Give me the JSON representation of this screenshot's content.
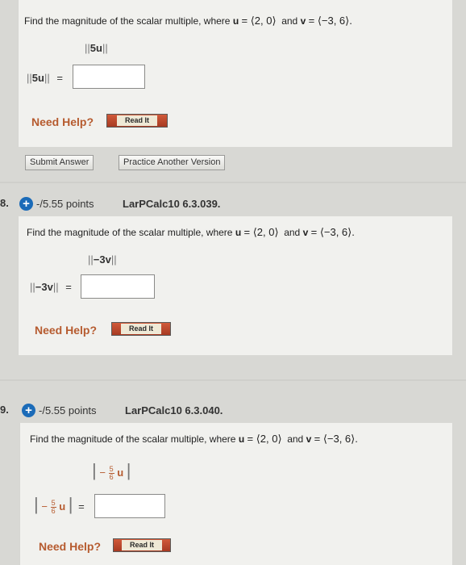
{
  "q1": {
    "prompt_prefix": "Find the magnitude of the scalar multiple, where",
    "u_label": "u",
    "u_value": "= ⟨2, 0⟩",
    "and": "and",
    "v_label": "v",
    "v_value": "= ⟨−3, 6⟩.",
    "norm_display": "5u",
    "answer_label": "5u",
    "equals": "=",
    "answer_value": "",
    "need_help": "Need Help?",
    "read_it": "Read It",
    "submit": "Submit Answer",
    "practice": "Practice Another Version"
  },
  "q2": {
    "number": "8.",
    "points": "-/5.55 points",
    "code": "LarPCalc10 6.3.039.",
    "prompt_prefix": "Find the magnitude of the scalar multiple, where",
    "u_label": "u",
    "u_value": "= ⟨2, 0⟩",
    "and": "and",
    "v_label": "v",
    "v_value": "= ⟨−3, 6⟩.",
    "norm_display": "−3v",
    "answer_label": "−3v",
    "equals": "=",
    "answer_value": "",
    "need_help": "Need Help?",
    "read_it": "Read It"
  },
  "q3": {
    "number": "9.",
    "points": "-/5.55 points",
    "code": "LarPCalc10 6.3.040.",
    "prompt_prefix": "Find the magnitude of the scalar multiple, where",
    "u_label": "u",
    "u_value": "= ⟨2, 0⟩",
    "and": "and",
    "v_label": "v",
    "v_value": "= ⟨−3, 6⟩.",
    "minus": "−",
    "frac_num": "5",
    "frac_den": "6",
    "vec": "u",
    "equals": "=",
    "answer_value": "",
    "need_help": "Need Help?",
    "read_it": "Read It"
  },
  "colors": {
    "accent_orange": "#b65b2f",
    "badge_blue": "#1b6bb8",
    "read_it_red": "#c0492e"
  },
  "icons": {
    "question_toggle": "plus-circle-icon"
  }
}
